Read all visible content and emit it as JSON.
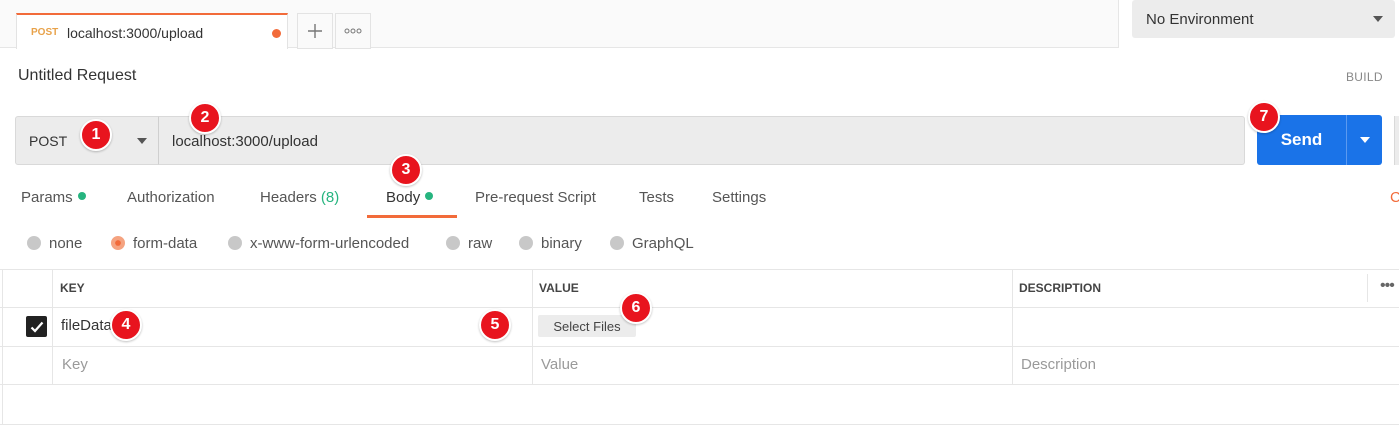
{
  "tab": {
    "method": "POST",
    "title": "localhost:3000/upload"
  },
  "environment": {
    "selected": "No Environment"
  },
  "request": {
    "title": "Untitled Request",
    "mode_label": "BUILD"
  },
  "url_bar": {
    "method": "POST",
    "url": "localhost:3000/upload",
    "send_label": "Send"
  },
  "request_tabs": {
    "params": "Params",
    "authorization": "Authorization",
    "headers": "Headers",
    "headers_count": "(8)",
    "body": "Body",
    "prerequest": "Pre-request Script",
    "tests": "Tests",
    "settings": "Settings",
    "cut_off": "C"
  },
  "body_types": [
    "none",
    "form-data",
    "x-www-form-urlencoded",
    "raw",
    "binary",
    "GraphQL"
  ],
  "body_type_selected": "form-data",
  "table": {
    "headers": {
      "key": "KEY",
      "value": "VALUE",
      "description": "DESCRIPTION"
    },
    "rows": [
      {
        "checked": true,
        "key": "fileData",
        "value_button": "Select Files",
        "description": ""
      }
    ],
    "placeholder": {
      "key": "Key",
      "value": "Value",
      "description": "Description"
    }
  },
  "markers": [
    "1",
    "2",
    "3",
    "4",
    "5",
    "6",
    "7"
  ],
  "colors": {
    "accent": "#f26b3a",
    "send": "#1a73e8",
    "active_dot": "#26b47f",
    "marker": "#e8141e"
  }
}
